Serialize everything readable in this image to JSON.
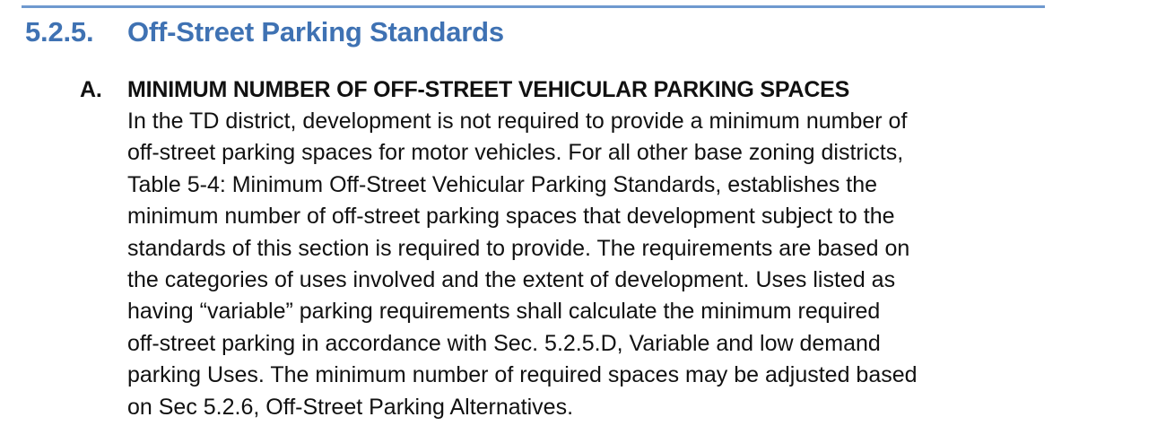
{
  "section": {
    "number": "5.2.5.",
    "title": "Off-Street Parking Standards"
  },
  "subsection": {
    "letter": "A.",
    "title": "MINIMUM NUMBER OF OFF-STREET VEHICULAR PARKING SPACES",
    "lines": [
      "In the TD district, development is not required to provide a minimum number of",
      "off-street parking spaces for motor vehicles. For all other base zoning districts,",
      "Table 5-4: Minimum Off-Street Vehicular Parking Standards, establishes the",
      "minimum number of off-street parking spaces that development subject to the",
      "standards of this section is required to provide. The requirements are based on",
      "the categories of uses involved and the extent of development. Uses listed as",
      "having “variable” parking requirements shall calculate the minimum required",
      "off-street parking in accordance with Sec. 5.2.5.D, Variable and low demand",
      "parking Uses. The minimum number of required spaces may be adjusted based",
      "on Sec 5.2.6, Off-Street Parking Alternatives."
    ]
  },
  "colors": {
    "heading": "#3f72b3",
    "rule": "#6f99cf",
    "text": "#111111"
  }
}
